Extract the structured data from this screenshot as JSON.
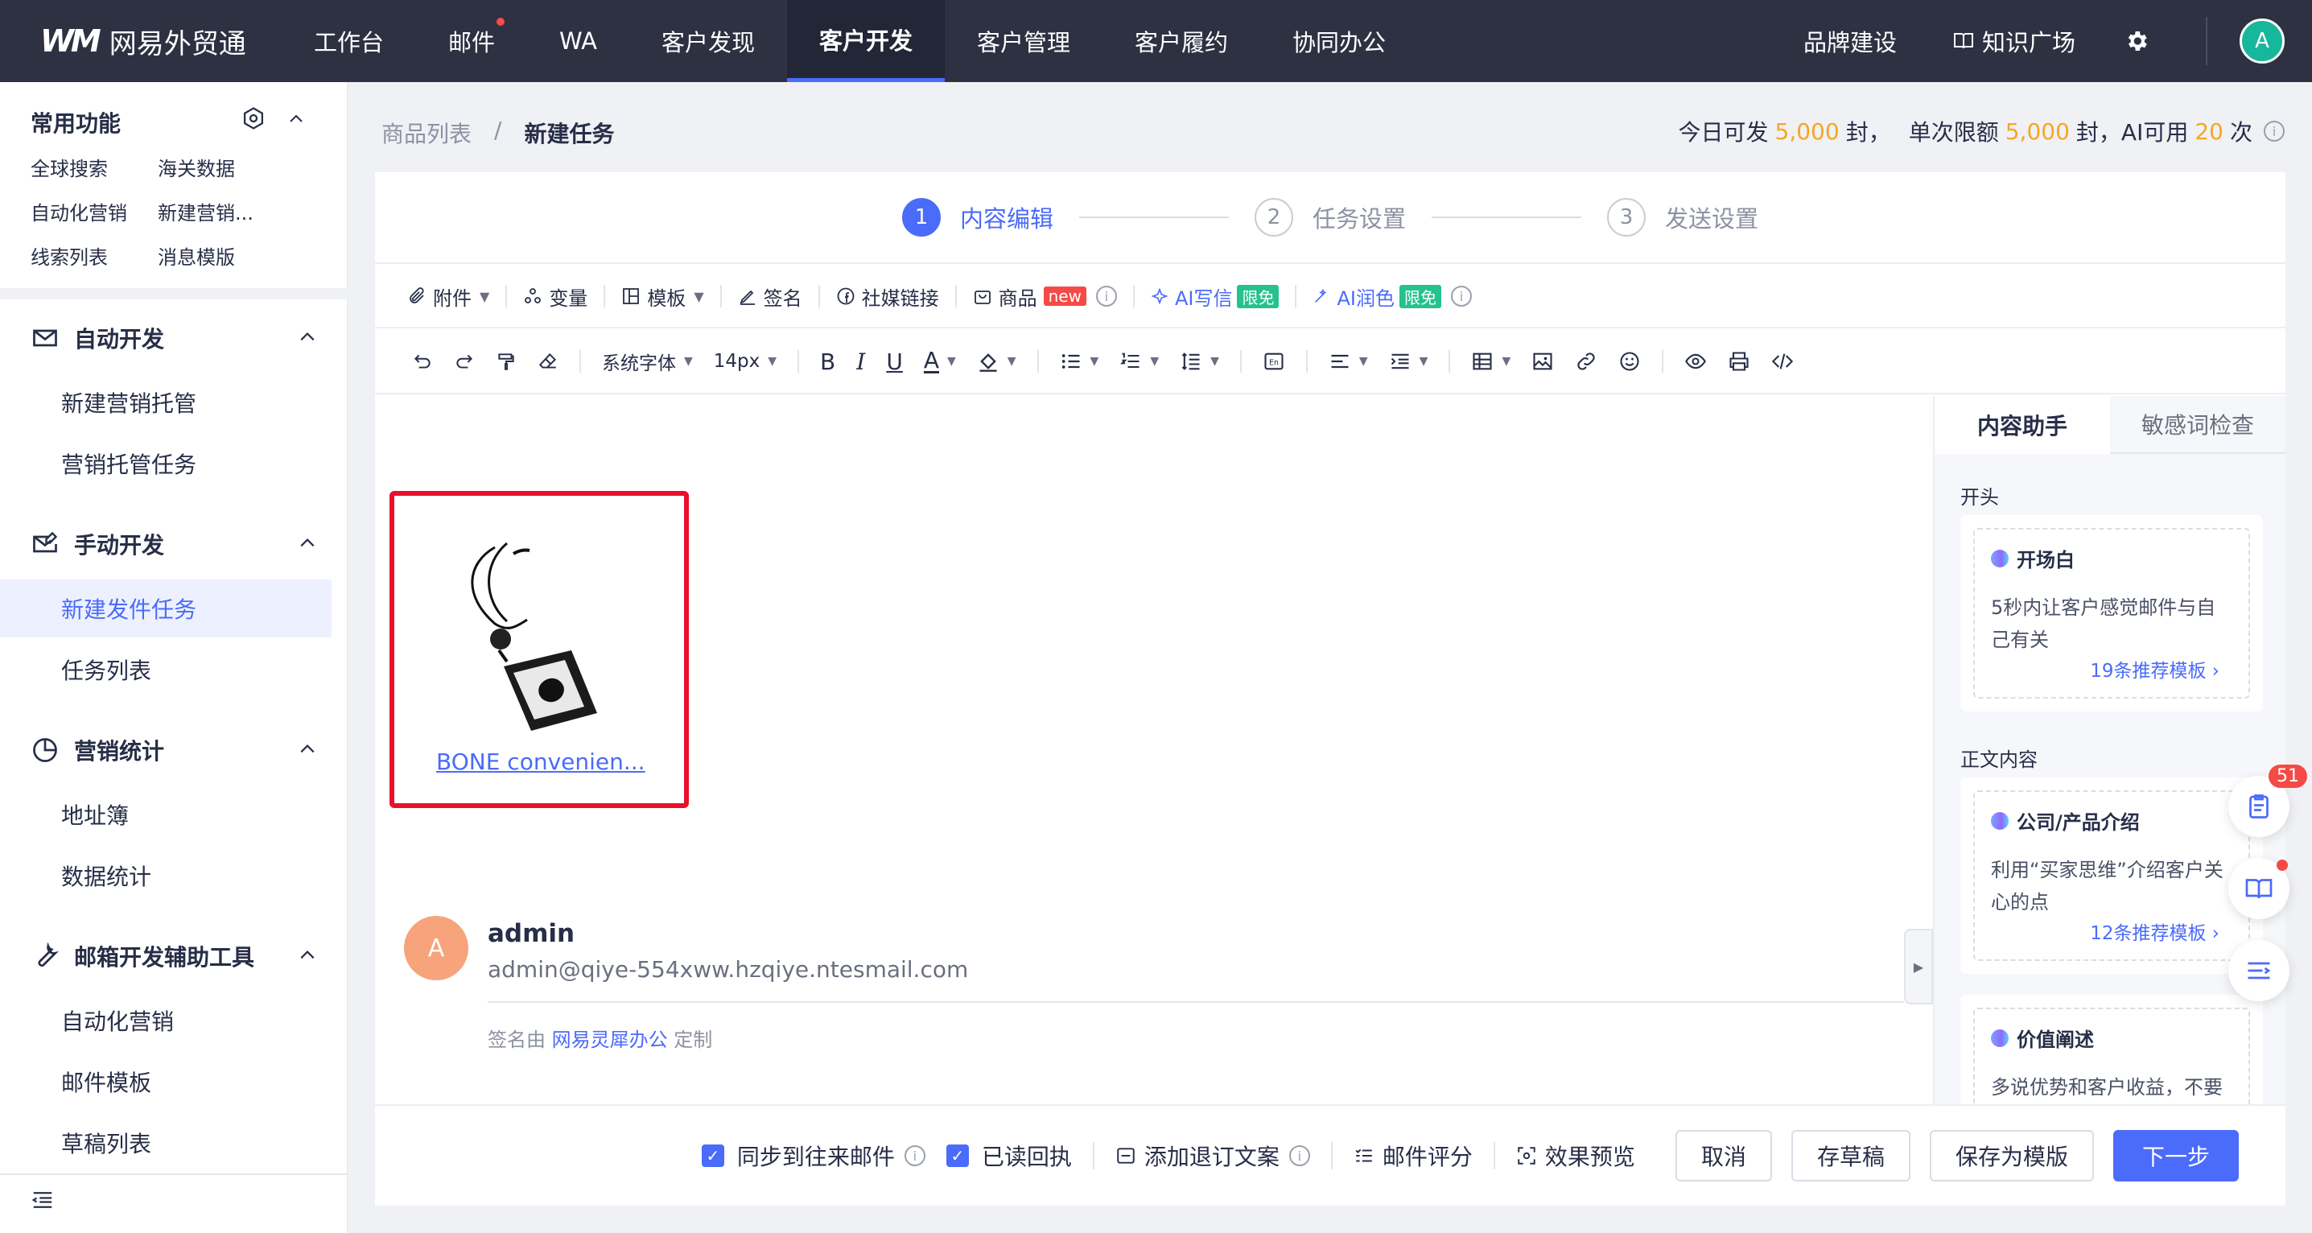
{
  "topnav": {
    "logo_mark": "WM",
    "logo_text": "网易外贸通",
    "items": [
      "工作台",
      "邮件",
      "WA",
      "客户发现",
      "客户开发",
      "客户管理",
      "客户履约",
      "协同办公"
    ],
    "active_index": 4,
    "right_items": {
      "brand": "品牌建设",
      "knowledge": "知识广场"
    },
    "avatar": "A"
  },
  "sidebar": {
    "common_title": "常用功能",
    "quick_links": [
      "全球搜索",
      "海关数据",
      "自动化营销",
      "新建营销...",
      "线索列表",
      "消息模版"
    ],
    "groups": [
      {
        "title": "自动开发",
        "items": [
          "新建营销托管",
          "营销托管任务"
        ]
      },
      {
        "title": "手动开发",
        "items": [
          "新建发件任务",
          "任务列表"
        ]
      },
      {
        "title": "营销统计",
        "items": [
          "地址簿",
          "数据统计"
        ]
      },
      {
        "title": "邮箱开发辅助工具",
        "items": [
          "自动化营销",
          "邮件模板",
          "草稿列表"
        ]
      }
    ],
    "active_item": "新建发件任务"
  },
  "breadcrumb": {
    "parent": "商品列表",
    "sep": "/",
    "current": "新建任务"
  },
  "quota": {
    "label1": "今日可发",
    "val1": "5,000",
    "unit1": "封，",
    "label2": "单次限额",
    "val2": "5,000",
    "unit2": "封，",
    "label3": "AI可用",
    "val3": "20",
    "unit3": "次"
  },
  "steps": [
    {
      "num": "1",
      "label": "内容编辑"
    },
    {
      "num": "2",
      "label": "任务设置"
    },
    {
      "num": "3",
      "label": "发送设置"
    }
  ],
  "toolbar1": {
    "attach": "附件",
    "variable": "变量",
    "template": "模板",
    "signature": "签名",
    "social": "社媒链接",
    "product": "商品",
    "new_badge": "new",
    "ai_write": "AI写信",
    "ai_polish": "AI润色",
    "free_badge": "限免"
  },
  "toolbar2": {
    "font": "系统字体",
    "size": "14px"
  },
  "editor": {
    "product_name": "BONE convenien...",
    "sig_avatar": "A",
    "sig_name": "admin",
    "sig_email": "admin@qiye-554xww.hzqiye.ntesmail.com",
    "sig_by_prefix": "签名由",
    "sig_by_link": "网易灵犀办公",
    "sig_by_suffix": "定制"
  },
  "panel": {
    "tabs": [
      "内容助手",
      "敏感词检查"
    ],
    "sec1": "开头",
    "card1": {
      "title": "开场白",
      "desc": "5秒内让客户感觉邮件与自己有关",
      "link": "19条推荐模板"
    },
    "sec2": "正文内容",
    "card2": {
      "title": "公司/产品介绍",
      "desc": "利用“买家思维”介绍客户关心的点",
      "link": "12条推荐模板"
    },
    "card3": {
      "title": "价值阐述",
      "desc": "多说优势和客户收益，不要"
    }
  },
  "footer": {
    "sync": "同步到往来邮件",
    "receipt": "已读回执",
    "unsub": "添加退订文案",
    "score": "邮件评分",
    "preview": "效果预览",
    "cancel": "取消",
    "draft": "存草稿",
    "save_tpl": "保存为模版",
    "next": "下一步"
  },
  "float": {
    "badge": "51"
  },
  "colors": {
    "accent": "#4b6bfa",
    "nav_bg": "#2d3142",
    "highlight": "#e8102b",
    "quota": "#f6a623"
  }
}
